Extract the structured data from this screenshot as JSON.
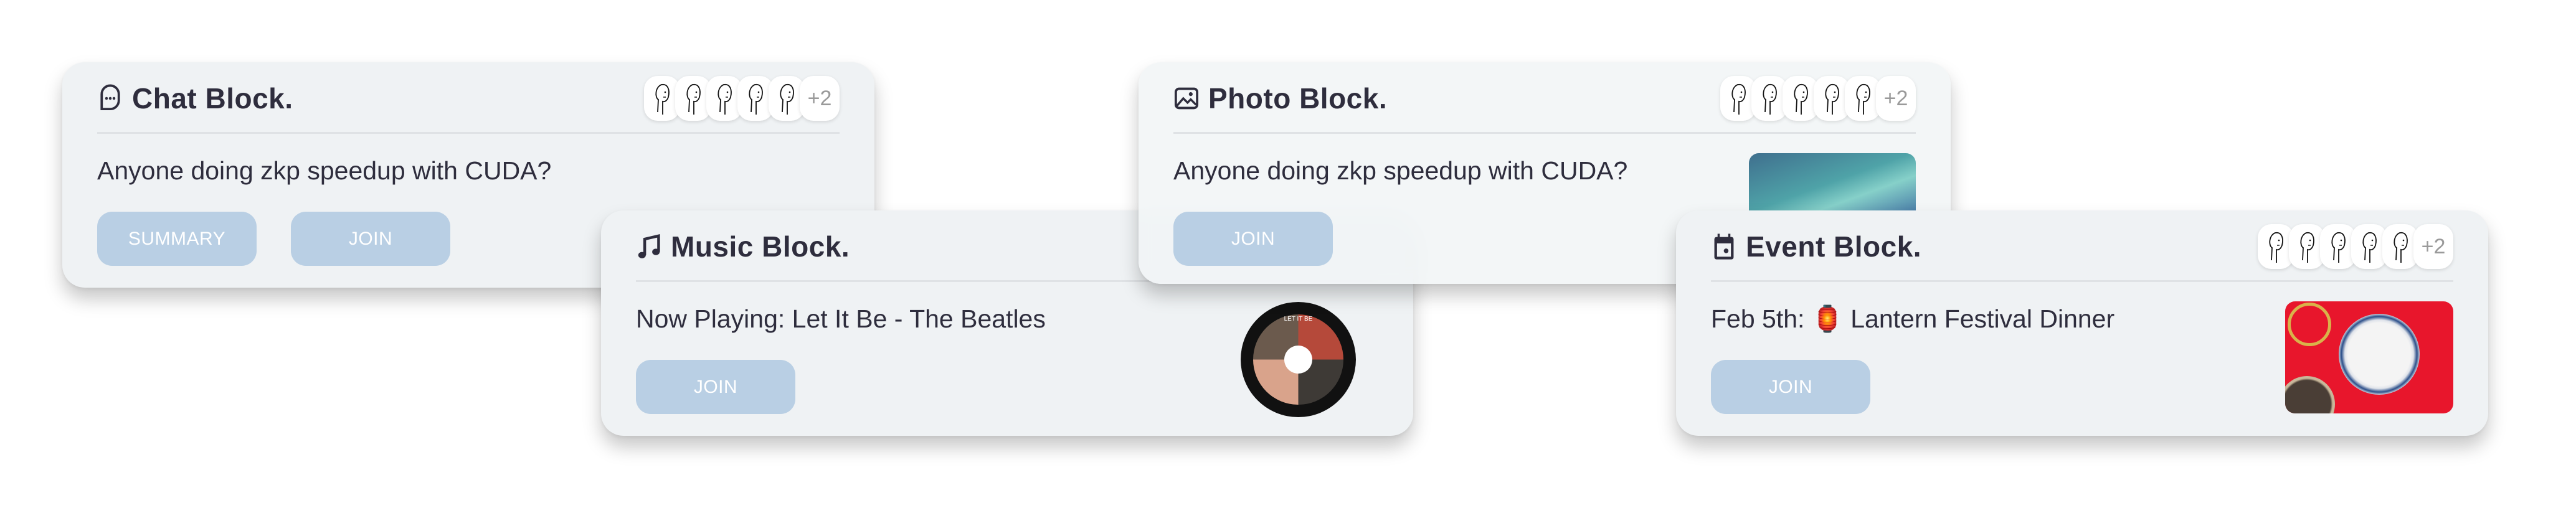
{
  "cards": {
    "chat": {
      "title": "Chat Block.",
      "icon": "chat-bubble-icon",
      "text": "Anyone doing zkp speedup with CUDA?",
      "summary_label": "SUMMARY",
      "join_label": "JOIN",
      "more_count": "+2"
    },
    "music": {
      "title": "Music Block.",
      "icon": "music-note-icon",
      "text": "Now Playing: Let It Be - The Beatles",
      "join_label": "JOIN",
      "album_cover_text": "LET IT BE"
    },
    "photo": {
      "title": "Photo Block.",
      "icon": "image-icon",
      "text": "Anyone doing zkp speedup with CUDA?",
      "join_label": "JOIN",
      "more_count": "+2"
    },
    "event": {
      "title": "Event Block.",
      "icon": "calendar-icon",
      "text": "Feb 5th: 🏮 Lantern Festival Dinner",
      "join_label": "JOIN",
      "more_count": "+2"
    }
  },
  "colors": {
    "button": "#b9cfe4",
    "card": "#eff2f4",
    "text": "#2e2d3d"
  }
}
